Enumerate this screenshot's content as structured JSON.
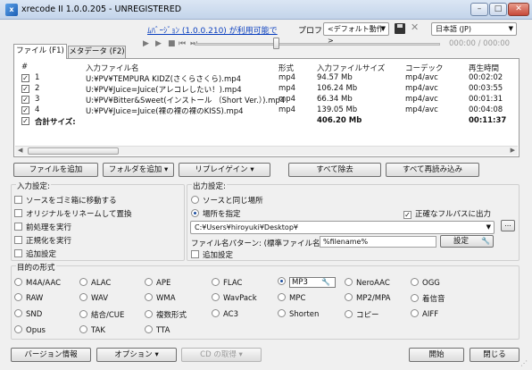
{
  "window": {
    "title": "xrecode II 1.0.0.205 - UNREGISTERED",
    "app_icon_glyph": "x"
  },
  "top": {
    "update_link": "ﾑﾊﾞｰｼﾞｮﾝ (1.0.0.210) が利用可能で",
    "profile_label": "プロファイル:",
    "profile_value": "<デフォルト動作>",
    "language_value": "日本語 (JP)"
  },
  "player": {
    "time": "000:00 / 000:00"
  },
  "tabs": [
    {
      "label": "ファイル (F1)"
    },
    {
      "label": "メタデータ (F2)"
    }
  ],
  "filelist": {
    "headers": {
      "num": "#",
      "input_file": "入力ファイル名",
      "format": "形式",
      "size": "入力ファイルサイズ",
      "codec": "コーデック",
      "duration": "再生時間"
    },
    "rows": [
      {
        "num": "1",
        "file": "U:¥PV¥TEMPURA KIDZ(さくらさくら).mp4",
        "format": "mp4",
        "size": "94.57 Mb",
        "codec": "mp4/avc",
        "duration": "00:02:02"
      },
      {
        "num": "2",
        "file": "U:¥PV¥Juice=Juice(アレコレしたい！).mp4",
        "format": "mp4",
        "size": "106.24 Mb",
        "codec": "mp4/avc",
        "duration": "00:03:55"
      },
      {
        "num": "3",
        "file": "U:¥PV¥Bitter&Sweet(インストール （Short Ver.）).mp4",
        "format": "mp4",
        "size": "66.34 Mb",
        "codec": "mp4/avc",
        "duration": "00:01:31"
      },
      {
        "num": "4",
        "file": "U:¥PV¥Juice=Juice(裸の裸の裸のKISS).mp4",
        "format": "mp4",
        "size": "139.05 Mb",
        "codec": "mp4/avc",
        "duration": "00:04:08"
      }
    ],
    "total": {
      "label": "合計サイズ:",
      "size": "406.20 Mb",
      "duration": "00:11:37"
    }
  },
  "actions": {
    "add_file": "ファイルを追加",
    "add_folder": "フォルダを追加",
    "replaygain": "リプレイゲイン",
    "remove_all": "すべて除去",
    "reread_all": "すべて再読み込み"
  },
  "input_settings": {
    "title": "入力設定:",
    "options": [
      "ソースをゴミ箱に移動する",
      "オリジナルをリネームして置換",
      "前処理を実行",
      "正規化を実行",
      "追加設定"
    ]
  },
  "output_settings": {
    "title": "出力設定:",
    "radio_same": "ソースと同じ場所",
    "radio_specify": "場所を指定",
    "fullpath_label": "正確なフルパスに出力",
    "path": "C:¥Users¥hiroyuki¥Desktop¥",
    "pattern_label": "ファイル名パターン: (標準ファイル名)",
    "pattern_value": "%filename%",
    "settings_button": "設定",
    "extra": "追加設定"
  },
  "formats": {
    "title": "目的の形式",
    "selected": "MP3",
    "rows": [
      [
        "M4A/AAC",
        "ALAC",
        "APE",
        "FLAC",
        "MP3",
        "NeroAAC",
        "OGG"
      ],
      [
        "RAW",
        "WAV",
        "WMA",
        "WavPack",
        "MPC",
        "MP2/MPA",
        "着信音"
      ],
      [
        "SND",
        "結合/CUE",
        "複数形式",
        "AC3",
        "Shorten",
        "コピー",
        "AIFF"
      ],
      [
        "Opus",
        "TAK",
        "TTA"
      ]
    ]
  },
  "bottom": {
    "version": "バージョン情報",
    "options": "オプション",
    "cd": "CD の取得",
    "start": "開始",
    "close": "閉じる"
  }
}
